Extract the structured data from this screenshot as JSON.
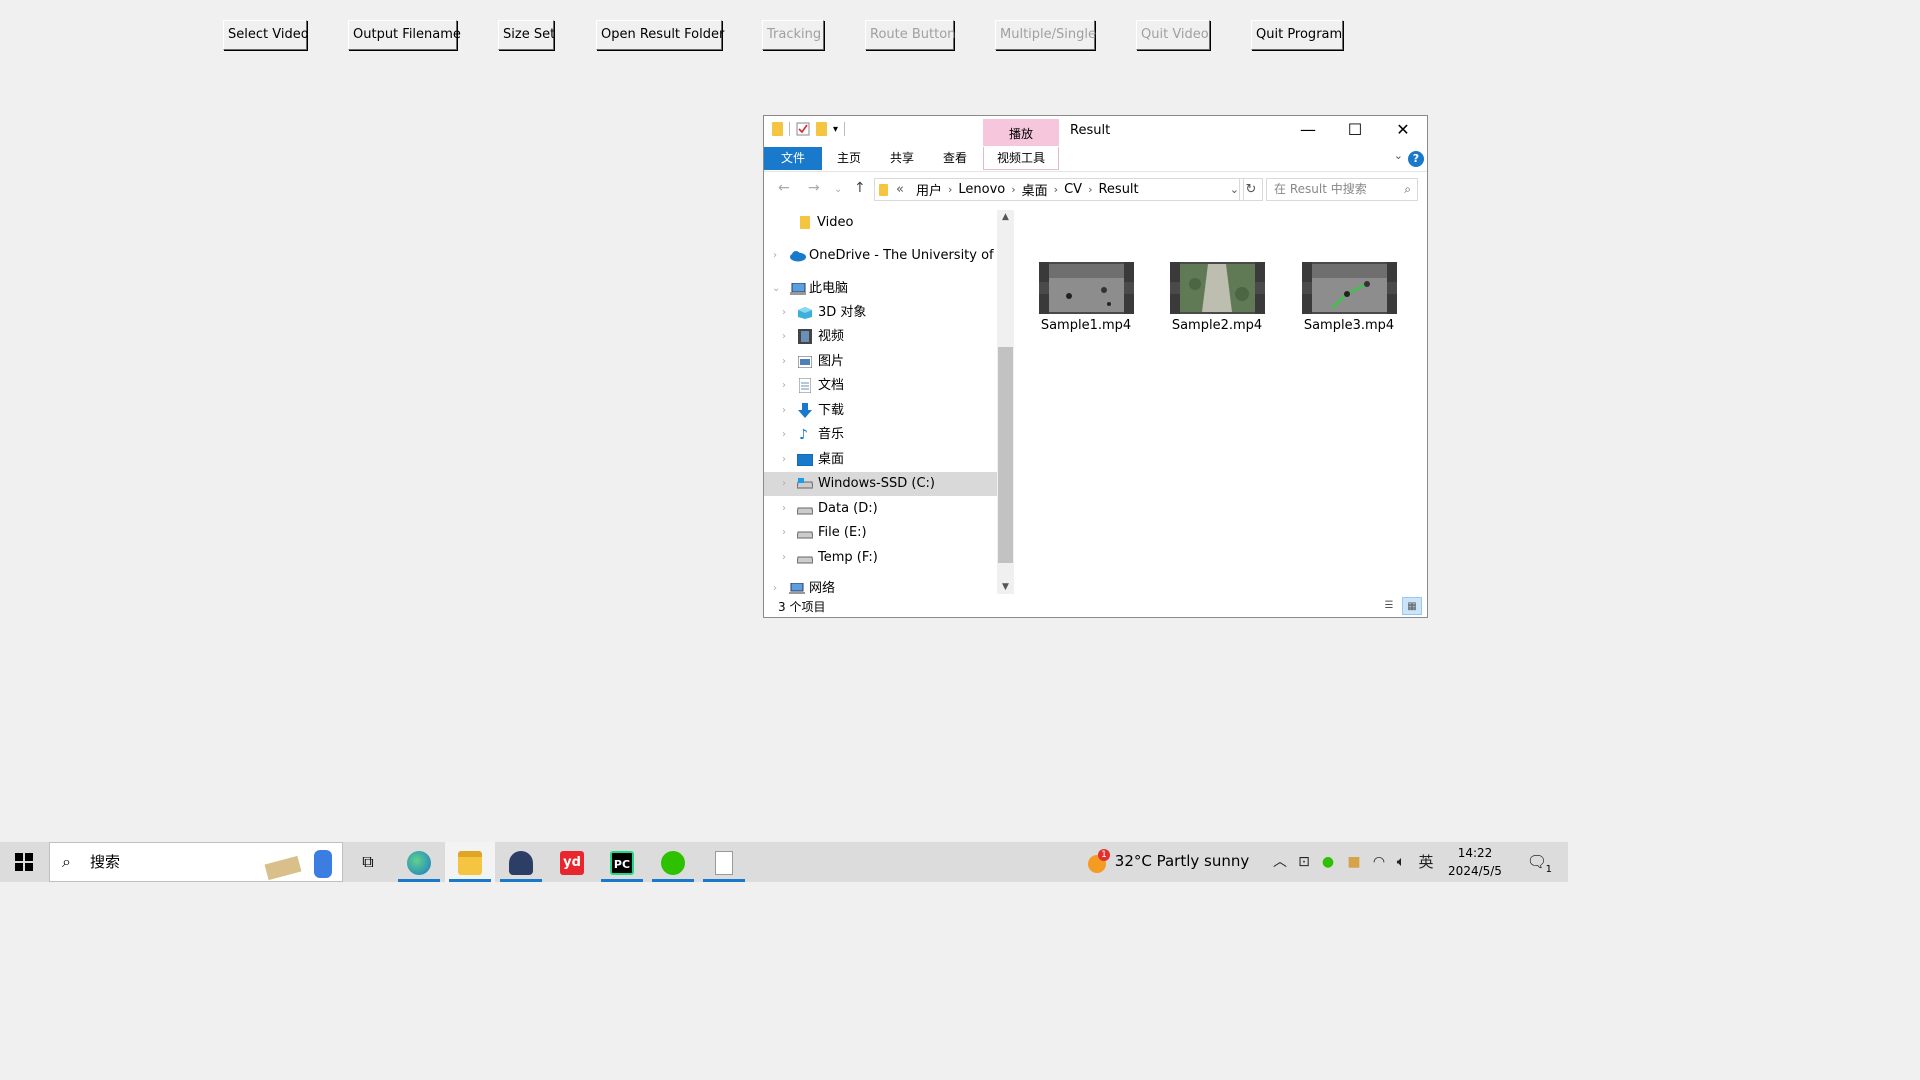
{
  "toolbar": {
    "buttons": [
      {
        "label": "Select Video",
        "enabled": true
      },
      {
        "label": "Output Filename",
        "enabled": true
      },
      {
        "label": "Size Set",
        "enabled": true
      },
      {
        "label": "Open Result Folder",
        "enabled": true
      },
      {
        "label": "Tracking",
        "enabled": false
      },
      {
        "label": "Route Button",
        "enabled": false
      },
      {
        "label": "Multiple/Single",
        "enabled": false
      },
      {
        "label": "Quit Video",
        "enabled": false
      },
      {
        "label": "Quit Program",
        "enabled": true
      }
    ]
  },
  "explorer": {
    "title": "Result",
    "context_tab_top": "播放",
    "ribbon_tabs": {
      "file": "文件",
      "home": "主页",
      "share": "共享",
      "view": "查看",
      "context": "视频工具"
    },
    "help": "?",
    "address": {
      "overflow": "«",
      "segments": [
        "用户",
        "Lenovo",
        "桌面",
        "CV",
        "Result"
      ]
    },
    "search_placeholder": "在 Result 中搜索",
    "nav_items": [
      {
        "label": "Video",
        "icon": "folder-icon"
      },
      {
        "label": "OneDrive - The University of No",
        "icon": "cloud-icon"
      },
      {
        "label": "此电脑",
        "icon": "computer-icon"
      },
      {
        "label": "3D 对象",
        "icon": "cube-icon"
      },
      {
        "label": "视频",
        "icon": "video-icon"
      },
      {
        "label": "图片",
        "icon": "picture-icon"
      },
      {
        "label": "文档",
        "icon": "document-icon"
      },
      {
        "label": "下载",
        "icon": "download-icon"
      },
      {
        "label": "音乐",
        "icon": "music-icon"
      },
      {
        "label": "桌面",
        "icon": "desktop-icon"
      },
      {
        "label": "Windows-SSD (C:)",
        "icon": "drive-icon"
      },
      {
        "label": "Data (D:)",
        "icon": "drive-icon"
      },
      {
        "label": "File (E:)",
        "icon": "drive-icon"
      },
      {
        "label": "Temp (F:)",
        "icon": "drive-icon"
      },
      {
        "label": "网络",
        "icon": "network-icon"
      }
    ],
    "selected_nav": "Windows-SSD (C:)",
    "files": [
      {
        "name": "Sample1.mp4"
      },
      {
        "name": "Sample2.mp4"
      },
      {
        "name": "Sample3.mp4"
      }
    ],
    "status": "3 个项目"
  },
  "taskbar": {
    "search_placeholder": "搜索",
    "weather": "32°C  Partly sunny",
    "weather_badge": "1",
    "ime": "英",
    "time": "14:22",
    "date": "2024/5/5",
    "notification_count": "1"
  },
  "colors": {
    "accent": "#1979ca",
    "context_tab": "#f6c7dc",
    "selection": "#d9d9d9"
  }
}
